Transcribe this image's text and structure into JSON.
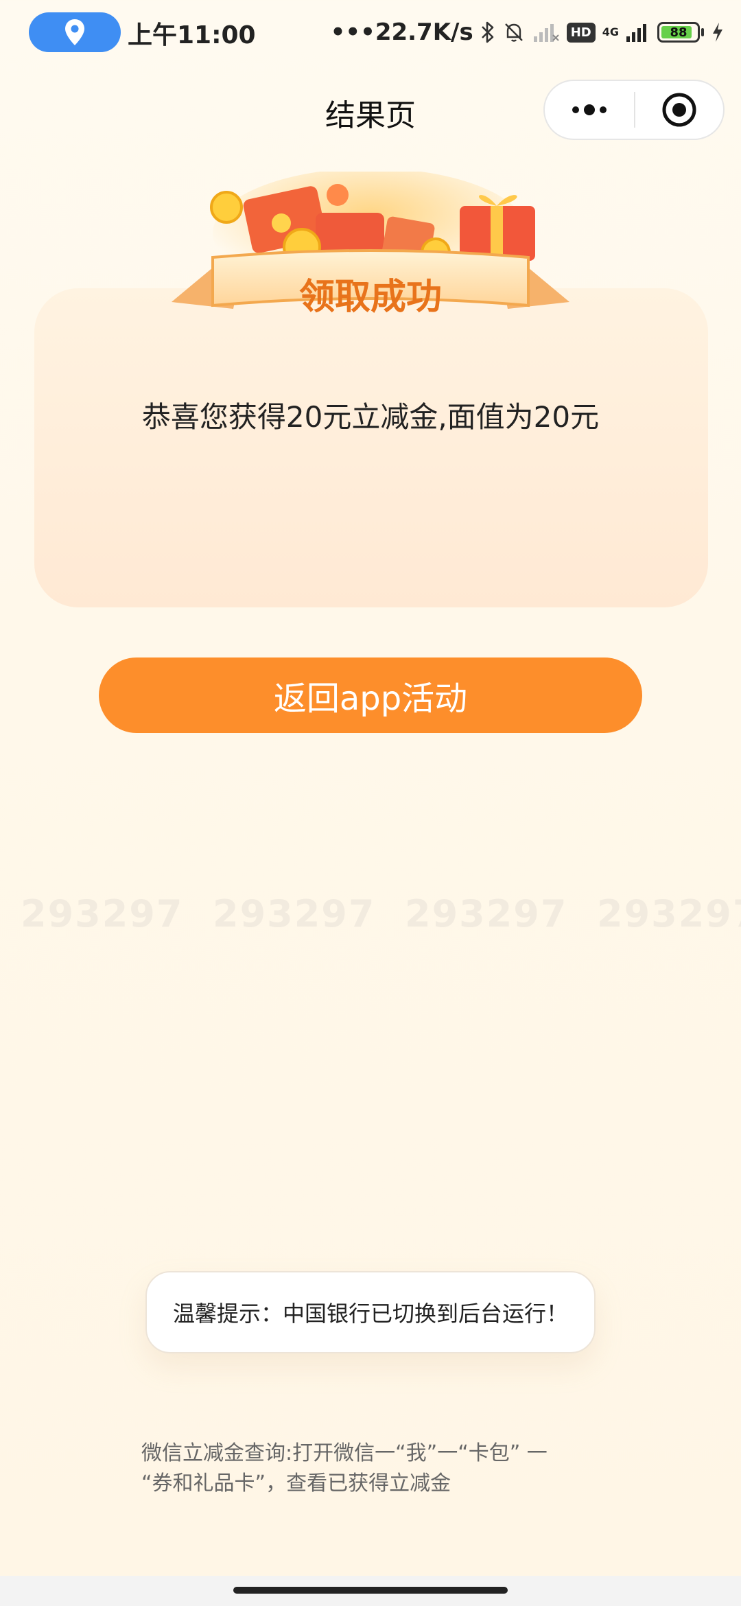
{
  "status_bar": {
    "time": "上午11:00",
    "net_speed": "•••22.7K/s",
    "hd_label": "HD",
    "network_label": "4G",
    "battery_level": "88"
  },
  "nav": {
    "title": "结果页"
  },
  "banner": {
    "title": "领取成功"
  },
  "card": {
    "message": "恭喜您获得20元立减金,面值为20元"
  },
  "actions": {
    "return_label": "返回app活动"
  },
  "watermark": {
    "text": "293297"
  },
  "toast": {
    "text": "温馨提示：中国银行已切换到后台运行！"
  },
  "footer": {
    "line1": "微信立减金查询:打开微信一“我”一“卡包” 一",
    "line2": "“券和礼品卡”，查看已获得立减金"
  },
  "colors": {
    "accent": "#fd8e2b",
    "banner_text": "#e8731b",
    "location_pill": "#3f8ef3"
  }
}
